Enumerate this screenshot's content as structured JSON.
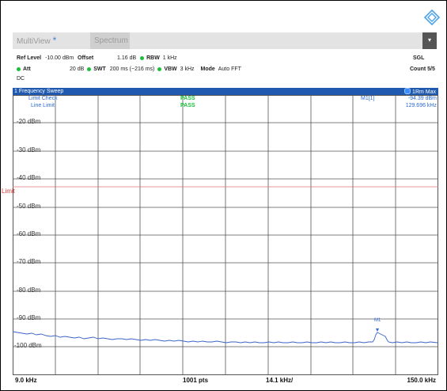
{
  "tabs": {
    "multiview": "MultiView",
    "multiview_marker": "*",
    "spectrum": "Spectrum",
    "menu": "▾"
  },
  "header": {
    "ref_level_label": "Ref Level",
    "ref_level_value": "-10.00 dBm",
    "offset_label": "Offset",
    "offset_value": "1.16 dB",
    "rbw_label": "RBW",
    "rbw_value": "1 kHz",
    "att_label": "Att",
    "att_value": "20 dB",
    "swt_label": "SWT",
    "swt_value": "200 ms (~216 ms)",
    "vbw_label": "VBW",
    "vbw_value": "3 kHz",
    "mode_label": "Mode",
    "mode_value": "Auto FFT",
    "coupling": "DC",
    "sgl": "SGL",
    "count": "Count 5/5"
  },
  "panel": {
    "title": "1 Frequency Sweep",
    "trace_mode": "1Rm Max",
    "limit_check_label": "Limit Check",
    "line_limit_label": "Line Limit",
    "limit_check_result": "PASS",
    "line_limit_result": "PASS",
    "marker_name": "M1[1]",
    "marker_level": "-94.39 dBm",
    "marker_freq": "129.696 kHz",
    "marker_tag": "M1",
    "limit_line_label": "Limit"
  },
  "y_axis": [
    "-20 dBm",
    "-30 dBm",
    "-40 dBm",
    "-50 dBm",
    "-60 dBm",
    "-70 dBm",
    "-80 dBm",
    "-90 dBm",
    "-100 dBm"
  ],
  "footer": {
    "start": "9.0 kHz",
    "points": "1001 pts",
    "span_per_div": "14.1 kHz/",
    "stop": "150.0 kHz"
  },
  "colors": {
    "header_bar": "#1f5ab0",
    "trace": "#3b63c9",
    "limit": "#e07070",
    "pass": "#1bbf3a",
    "label_blue": "#2b6ad8"
  }
}
